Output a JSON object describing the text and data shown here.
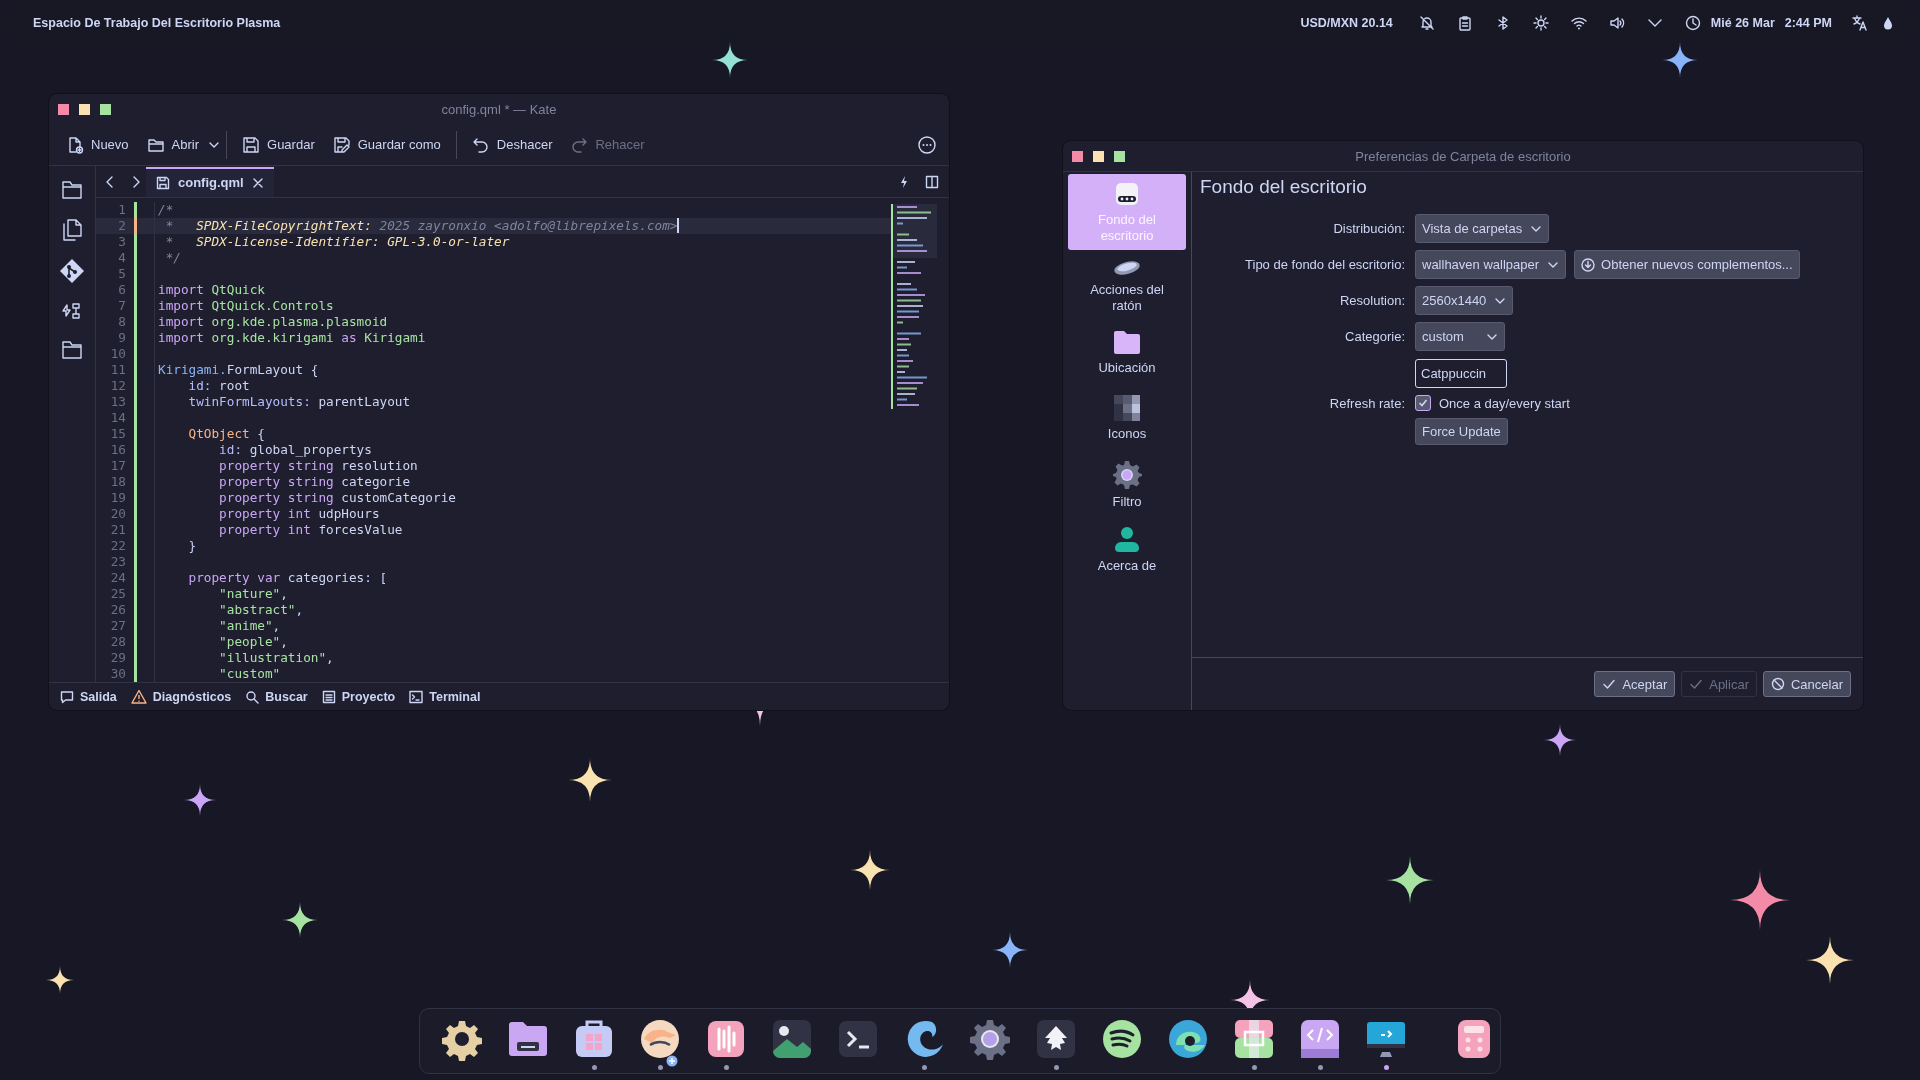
{
  "panel": {
    "title": "Espacio De Trabajo Del Escritorio Plasma",
    "ticker": "USD/MXN 20.14",
    "date": "Mié 26 Mar",
    "time": "2:44 PM"
  },
  "kate": {
    "title": "config.qml * — Kate",
    "toolbar": [
      [
        {
          "label": "Nuevo",
          "disabled": false,
          "menu": false
        },
        {
          "label": "Abrir",
          "disabled": false,
          "menu": true
        }
      ],
      [
        {
          "label": "Guardar",
          "disabled": false,
          "menu": false
        },
        {
          "label": "Guardar como",
          "disabled": false,
          "menu": false
        }
      ],
      [
        {
          "label": "Deshacer",
          "disabled": false,
          "menu": false
        },
        {
          "label": "Rehacer",
          "disabled": true,
          "menu": false
        }
      ]
    ],
    "tabs": [
      {
        "label": "config.qml",
        "selected": true
      }
    ],
    "lines": [
      {
        "number": "1",
        "unsaved": false,
        "current": false,
        "tokens": [
          {
            "kind": "comment",
            "text": "/*"
          }
        ]
      },
      {
        "number": "2",
        "unsaved": true,
        "current": true,
        "tokens": [
          {
            "kind": "comment",
            "text": " *   "
          },
          {
            "kind": "tag",
            "text": "SPDX-FileCopyrightText:"
          },
          {
            "kind": "comment",
            "text": " 2025 zayronxio <adolfo@librepixels.com>"
          }
        ]
      },
      {
        "number": "3",
        "unsaved": false,
        "current": false,
        "tokens": [
          {
            "kind": "comment",
            "text": " *   "
          },
          {
            "kind": "tag",
            "text": "SPDX-License-Identifier: GPL-3.0-or-later"
          }
        ]
      },
      {
        "number": "4",
        "unsaved": false,
        "current": false,
        "tokens": [
          {
            "kind": "comment",
            "text": " */"
          }
        ]
      },
      {
        "number": "5",
        "unsaved": false,
        "current": false
      },
      {
        "number": "6",
        "unsaved": false,
        "current": false,
        "tokens": [
          {
            "kind": "keyword",
            "text": "import "
          },
          {
            "kind": "module",
            "text": "QtQuick"
          }
        ]
      },
      {
        "number": "7",
        "unsaved": false,
        "current": false,
        "tokens": [
          {
            "kind": "keyword",
            "text": "import "
          },
          {
            "kind": "module",
            "text": "QtQuick.Controls"
          }
        ]
      },
      {
        "number": "8",
        "unsaved": false,
        "current": false,
        "tokens": [
          {
            "kind": "keyword",
            "text": "import "
          },
          {
            "kind": "module",
            "text": "org.kde.plasma.plasmoid"
          }
        ]
      },
      {
        "number": "9",
        "unsaved": false,
        "current": false,
        "tokens": [
          {
            "kind": "keyword",
            "text": "import "
          },
          {
            "kind": "module",
            "text": "org.kde.kirigami "
          },
          {
            "kind": "keyword",
            "text": "as "
          },
          {
            "kind": "module",
            "text": "Kirigami"
          }
        ]
      },
      {
        "number": "10",
        "unsaved": false,
        "current": false
      },
      {
        "number": "11",
        "unsaved": false,
        "current": false,
        "tokens": [
          {
            "kind": "type",
            "text": "Kirigami."
          },
          {
            "kind": "plain",
            "text": "FormLayout {"
          }
        ]
      },
      {
        "number": "12",
        "unsaved": false,
        "current": false,
        "tokens": [
          {
            "kind": "prop",
            "text": "    id:"
          },
          {
            "kind": "plain",
            "text": " root"
          }
        ]
      },
      {
        "number": "13",
        "unsaved": false,
        "current": false,
        "tokens": [
          {
            "kind": "prop",
            "text": "    twinFormLayouts:"
          },
          {
            "kind": "plain",
            "text": " parentLayout"
          }
        ]
      },
      {
        "number": "14",
        "unsaved": false,
        "current": false
      },
      {
        "number": "15",
        "unsaved": false,
        "current": false,
        "tokens": [
          {
            "kind": "object",
            "text": "    QtObject"
          },
          {
            "kind": "plain",
            "text": " {"
          }
        ]
      },
      {
        "number": "16",
        "unsaved": false,
        "current": false,
        "tokens": [
          {
            "kind": "prop",
            "text": "        id:"
          },
          {
            "kind": "plain",
            "text": " global_propertys"
          }
        ]
      },
      {
        "number": "17",
        "unsaved": false,
        "current": false,
        "tokens": [
          {
            "kind": "keyword",
            "text": "        property string"
          },
          {
            "kind": "plain",
            "text": " resolution"
          }
        ]
      },
      {
        "number": "18",
        "unsaved": false,
        "current": false,
        "tokens": [
          {
            "kind": "keyword",
            "text": "        property string"
          },
          {
            "kind": "plain",
            "text": " categorie"
          }
        ]
      },
      {
        "number": "19",
        "unsaved": false,
        "current": false,
        "tokens": [
          {
            "kind": "keyword",
            "text": "        property string"
          },
          {
            "kind": "plain",
            "text": " customCategorie"
          }
        ]
      },
      {
        "number": "20",
        "unsaved": false,
        "current": false,
        "tokens": [
          {
            "kind": "keyword",
            "text": "        property int"
          },
          {
            "kind": "plain",
            "text": " udpHours"
          }
        ]
      },
      {
        "number": "21",
        "unsaved": false,
        "current": false,
        "tokens": [
          {
            "kind": "keyword",
            "text": "        property int"
          },
          {
            "kind": "plain",
            "text": " forcesValue"
          }
        ]
      },
      {
        "number": "22",
        "unsaved": false,
        "current": false,
        "tokens": [
          {
            "kind": "plain",
            "text": "    }"
          }
        ]
      },
      {
        "number": "23",
        "unsaved": false,
        "current": false
      },
      {
        "number": "24",
        "unsaved": false,
        "current": false,
        "tokens": [
          {
            "kind": "keyword",
            "text": "    property var"
          },
          {
            "kind": "plain",
            "text": " categories: ["
          }
        ]
      },
      {
        "number": "25",
        "unsaved": false,
        "current": false,
        "tokens": [
          {
            "kind": "string",
            "text": "        \"nature\""
          },
          {
            "kind": "plain",
            "text": ","
          }
        ]
      },
      {
        "number": "26",
        "unsaved": false,
        "current": false,
        "tokens": [
          {
            "kind": "string",
            "text": "        \"abstract\""
          },
          {
            "kind": "plain",
            "text": ","
          }
        ]
      },
      {
        "number": "27",
        "unsaved": false,
        "current": false,
        "tokens": [
          {
            "kind": "string",
            "text": "        \"anime\""
          },
          {
            "kind": "plain",
            "text": ","
          }
        ]
      },
      {
        "number": "28",
        "unsaved": false,
        "current": false,
        "tokens": [
          {
            "kind": "string",
            "text": "        \"people\""
          },
          {
            "kind": "plain",
            "text": ","
          }
        ]
      },
      {
        "number": "29",
        "unsaved": false,
        "current": false,
        "tokens": [
          {
            "kind": "string",
            "text": "        \"illustration\""
          },
          {
            "kind": "plain",
            "text": ","
          }
        ]
      },
      {
        "number": "30",
        "unsaved": false,
        "current": false,
        "tokens": [
          {
            "kind": "string",
            "text": "        \"custom\""
          }
        ]
      }
    ],
    "bottom_tabs": [
      "Salida",
      "Diagnósticos",
      "Buscar",
      "Proyecto",
      "Terminal"
    ]
  },
  "prefs": {
    "title": "Preferencias de Carpeta de escritorio",
    "sidebar": [
      {
        "label": "Fondo del escritorio",
        "selected": true
      },
      {
        "label": "Acciones del ratón",
        "selected": false
      },
      {
        "label": "Ubicación",
        "selected": false
      },
      {
        "label": "Iconos",
        "selected": false
      },
      {
        "label": "Filtro",
        "selected": false
      },
      {
        "label": "Acerca de",
        "selected": false
      }
    ],
    "heading": "Fondo del escritorio",
    "form": [
      {
        "kind": "select",
        "label": "Distribución:",
        "value": "Vista de carpetas"
      },
      {
        "kind": "select",
        "label": "Tipo de fondo del escritorio:",
        "value": "wallhaven wallpaper",
        "extra_button": "Obtener nuevos complementos..."
      },
      {
        "kind": "select",
        "label": "Resolution:",
        "value": "2560x1440"
      },
      {
        "kind": "select",
        "label": "Categorie:",
        "value": "custom"
      },
      {
        "kind": "text",
        "value": "Catppuccin"
      },
      {
        "kind": "checkbox",
        "label": "Refresh rate:",
        "text": "Once a day/every start",
        "checked": true
      },
      {
        "kind": "button",
        "text": "Force Update"
      }
    ],
    "buttons": [
      {
        "label": "Aceptar",
        "disabled": false,
        "kind": "ok"
      },
      {
        "label": "Aplicar",
        "disabled": true,
        "kind": "ok"
      },
      {
        "label": "Cancelar",
        "disabled": false,
        "kind": "cancel"
      }
    ]
  },
  "dock": {
    "items": [
      {
        "running": false,
        "active": false
      },
      {
        "running": false,
        "active": false
      },
      {
        "running": true,
        "active": false
      },
      {
        "running": true,
        "active": false
      },
      {
        "running": true,
        "active": false
      },
      {
        "running": false,
        "active": false
      },
      {
        "running": false,
        "active": false
      },
      {
        "running": true,
        "active": false
      },
      {
        "running": false,
        "active": false
      },
      {
        "running": true,
        "active": false
      },
      {
        "running": false,
        "active": false
      },
      {
        "running": false,
        "active": false
      },
      {
        "running": true,
        "active": false
      },
      {
        "running": true,
        "active": false
      },
      {
        "running": true,
        "active": true
      },
      {
        "running": false,
        "active": false
      }
    ]
  }
}
